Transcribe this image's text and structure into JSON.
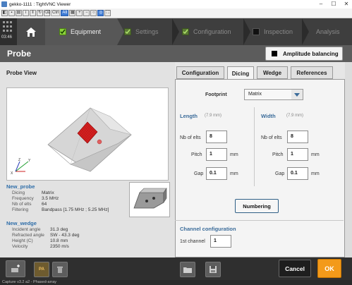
{
  "window": {
    "title": "gekko-1111 : TightVNC Viewer"
  },
  "vnc_toolbar": {
    "ctrl_label": "Ctrl",
    "alt_label": "Alt"
  },
  "nav": {
    "clock": "03:46",
    "steps": [
      {
        "label": "Equipment",
        "state": "active"
      },
      {
        "label": "Settings",
        "state": "done"
      },
      {
        "label": "Configuration",
        "state": "done"
      },
      {
        "label": "Inspection",
        "state": "pending"
      },
      {
        "label": "Analysis",
        "state": "pending"
      }
    ]
  },
  "page": {
    "title": "Probe",
    "amplitude_button": "Amplitude balancing"
  },
  "left": {
    "probe_view_label": "Probe View",
    "probe": {
      "name": "New_probe",
      "rows": [
        {
          "k": "Dicing",
          "v": "Matrix"
        },
        {
          "k": "Frequency",
          "v": "3.5 MHz"
        },
        {
          "k": "Nb of elts",
          "v": "64"
        },
        {
          "k": "Filtering",
          "v": "Bandpass [1.75 MHz ; 5.25 MHz]"
        }
      ]
    },
    "wedge": {
      "name": "New_wedge",
      "rows": [
        {
          "k": "Incident angle",
          "v": "31.3 deg"
        },
        {
          "k": "Refracted angle",
          "v": "SW - 43.3 deg"
        },
        {
          "k": "Height (C)",
          "v": "10.8 mm"
        },
        {
          "k": "Velocity",
          "v": "2350 m/s"
        }
      ]
    }
  },
  "tabs": [
    "Configuration",
    "Dicing",
    "Wedge",
    "References"
  ],
  "dicing": {
    "footprint_label": "Footprint",
    "footprint_value": "Matrix",
    "length": {
      "title": "Length",
      "size": "(7.9 mm)",
      "nb_label": "Nb of elts",
      "nb": "8",
      "pitch_label": "Pitch",
      "pitch": "1",
      "gap_label": "Gap",
      "gap": "0.1",
      "unit": "mm"
    },
    "width": {
      "title": "Width",
      "size": "(7.9 mm)",
      "nb_label": "Nb of elts",
      "nb": "8",
      "pitch_label": "Pitch",
      "pitch": "1",
      "gap_label": "Gap",
      "gap": "0.1",
      "unit": "mm"
    },
    "numbering_button": "Numbering",
    "channel_title": "Channel configuration",
    "first_channel_label": "1st channel",
    "first_channel": "1"
  },
  "bottom": {
    "pa_label": "PA",
    "cancel": "Cancel",
    "ok": "OK"
  },
  "status": "Capture v3.2 a2 - Phased-array",
  "colors": {
    "accent_green": "#8bd13b",
    "ok_orange": "#f39a1a",
    "section_blue": "#3b6c9a",
    "probe_red": "#d42020"
  }
}
